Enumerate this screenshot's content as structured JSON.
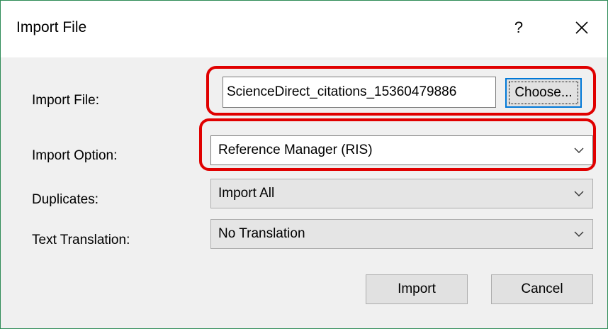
{
  "window": {
    "title": "Import File",
    "help_label": "?",
    "border_color": "#2e8b57"
  },
  "form": {
    "import_file": {
      "label": "Import File:",
      "value": "ScienceDirect_citations_15360479886",
      "choose_label": "Choose..."
    },
    "import_option": {
      "label": "Import Option:",
      "selected": "Reference Manager (RIS)"
    },
    "duplicates": {
      "label": "Duplicates:",
      "selected": "Import All"
    },
    "text_translation": {
      "label": "Text Translation:",
      "selected": "No Translation"
    }
  },
  "buttons": {
    "import_label": "Import",
    "cancel_label": "Cancel"
  },
  "icons": {
    "close": "close-icon",
    "dropdown": "chevron-down-icon"
  },
  "colors": {
    "highlight": "#e00000",
    "focus": "#0078d7"
  }
}
